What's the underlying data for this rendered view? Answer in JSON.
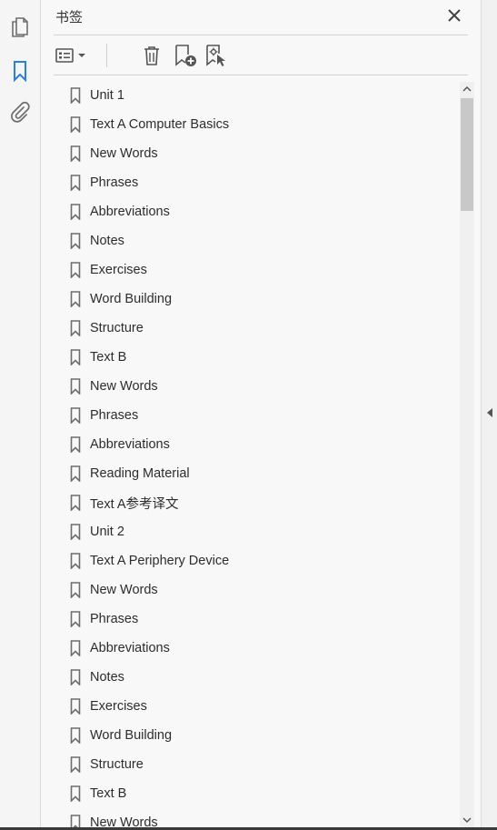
{
  "rail": {
    "items": [
      {
        "name": "pages-icon",
        "active": false
      },
      {
        "name": "bookmark-icon",
        "active": true
      },
      {
        "name": "paperclip-icon",
        "active": false
      }
    ]
  },
  "panel": {
    "title": "书签",
    "close_icon": "close-icon"
  },
  "toolbar": {
    "buttons": [
      "options-menu-icon",
      "delete-icon",
      "new-bookmark-icon",
      "new-bookmark-from-selection-icon"
    ]
  },
  "bookmarks": [
    "Unit 1",
    "Text A Computer Basics",
    "New Words",
    "Phrases",
    "Abbreviations",
    "Notes",
    "Exercises",
    "Word Building",
    "Structure",
    "Text B",
    "New Words",
    "Phrases",
    "Abbreviations",
    "Reading Material",
    "Text A参考译文",
    "Unit 2",
    "Text A Periphery Device",
    "New Words",
    "Phrases",
    "Abbreviations",
    "Notes",
    "Exercises",
    "Word Building",
    "Structure",
    "Text B",
    "New Words"
  ],
  "colors": {
    "accent": "#2680eb",
    "icon": "#6e6e6e"
  }
}
